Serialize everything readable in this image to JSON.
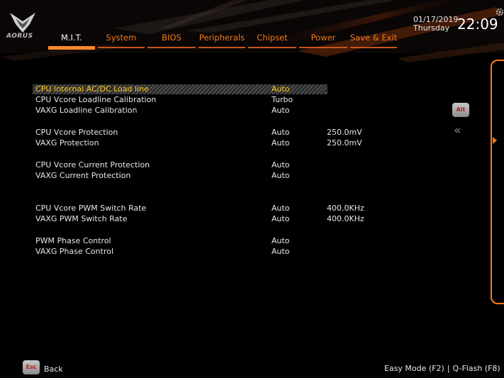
{
  "brand": {
    "logo_text": "AORUS"
  },
  "clock": {
    "date": "01/17/2019",
    "day": "Thursday",
    "time": "22:09"
  },
  "tabs": [
    {
      "label": "M.I.T.",
      "active": true
    },
    {
      "label": "System",
      "active": false
    },
    {
      "label": "BIOS",
      "active": false
    },
    {
      "label": "Peripherals",
      "active": false
    },
    {
      "label": "Chipset",
      "active": false
    },
    {
      "label": "Power",
      "active": false
    },
    {
      "label": "Save & Exit",
      "active": false
    }
  ],
  "settings": [
    {
      "label": "CPU Internal AC/DC Load line",
      "value": "Auto",
      "extra": "",
      "selected": true
    },
    {
      "label": "CPU Vcore Loadline Calibration",
      "value": "Turbo",
      "extra": ""
    },
    {
      "label": "VAXG Loadline Calibration",
      "value": "Auto",
      "extra": ""
    },
    {
      "label": "CPU Vcore Protection",
      "value": "Auto",
      "extra": "250.0mV"
    },
    {
      "label": "VAXG Protection",
      "value": "Auto",
      "extra": "250.0mV"
    },
    {
      "label": "CPU Vcore Current Protection",
      "value": "Auto",
      "extra": ""
    },
    {
      "label": "VAXG Current Protection",
      "value": "Auto",
      "extra": ""
    },
    {
      "label": "CPU Vcore PWM Switch Rate",
      "value": "Auto",
      "extra": "400.0KHz"
    },
    {
      "label": "VAXG PWM Switch Rate",
      "value": "Auto",
      "extra": "400.0KHz"
    },
    {
      "label": "PWM Phase Control",
      "value": "Auto",
      "extra": ""
    },
    {
      "label": "VAXG Phase Control",
      "value": "Auto",
      "extra": ""
    }
  ],
  "side": {
    "alt_key": "Alt",
    "collapse_icon": "double-chevron-left-icon"
  },
  "footer": {
    "esc_key": "Esc",
    "back_label": "Back",
    "easy_mode": "Easy Mode (F2)",
    "separator": "|",
    "qflash": "Q-Flash (F8)"
  },
  "colors": {
    "accent": "#ff7a1c",
    "selected_text": "#f5c518",
    "background": "#000000"
  }
}
